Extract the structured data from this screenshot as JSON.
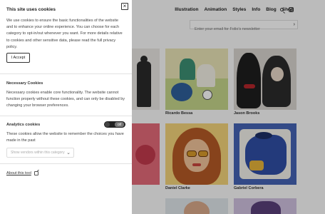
{
  "site": {
    "nav": [
      "Illustration",
      "Animation",
      "Styles",
      "Info",
      "Blog",
      "Shop"
    ],
    "newsletter_placeholder": "Enter your email for Folio's newsletter",
    "tiles": [
      {
        "caption": ""
      },
      {
        "caption": "Ricardo Bessa"
      },
      {
        "caption": "Jason Brooks"
      },
      {
        "caption": ""
      },
      {
        "caption": "Daniel Clarke"
      },
      {
        "caption": "Gabriel Corbera"
      }
    ]
  },
  "dialog": {
    "title": "This site uses cookies",
    "close_label": "×",
    "intro": "We use cookies to ensure the basic functionalities of the website and to enhance your online experience. You can choose for each category to opt-in/out whenever you want. For more details relative to cookies and other sensitive data, please read the full privacy policy.",
    "accept_label": "I Accept",
    "necessary": {
      "heading": "Necessary Cookies",
      "text": "Necessary cookies enable core functionality. The website cannot function properly without these cookies, and can only be disabled by changing your browser preferences."
    },
    "analytics": {
      "heading": "Analytics cookies",
      "toggle_label": "Off",
      "toggle_on": false,
      "text": "These cookies allow the website to remember the choices you have made in the past",
      "vendors_button": "Show vendors within this category"
    },
    "about_link": "About this tool"
  }
}
